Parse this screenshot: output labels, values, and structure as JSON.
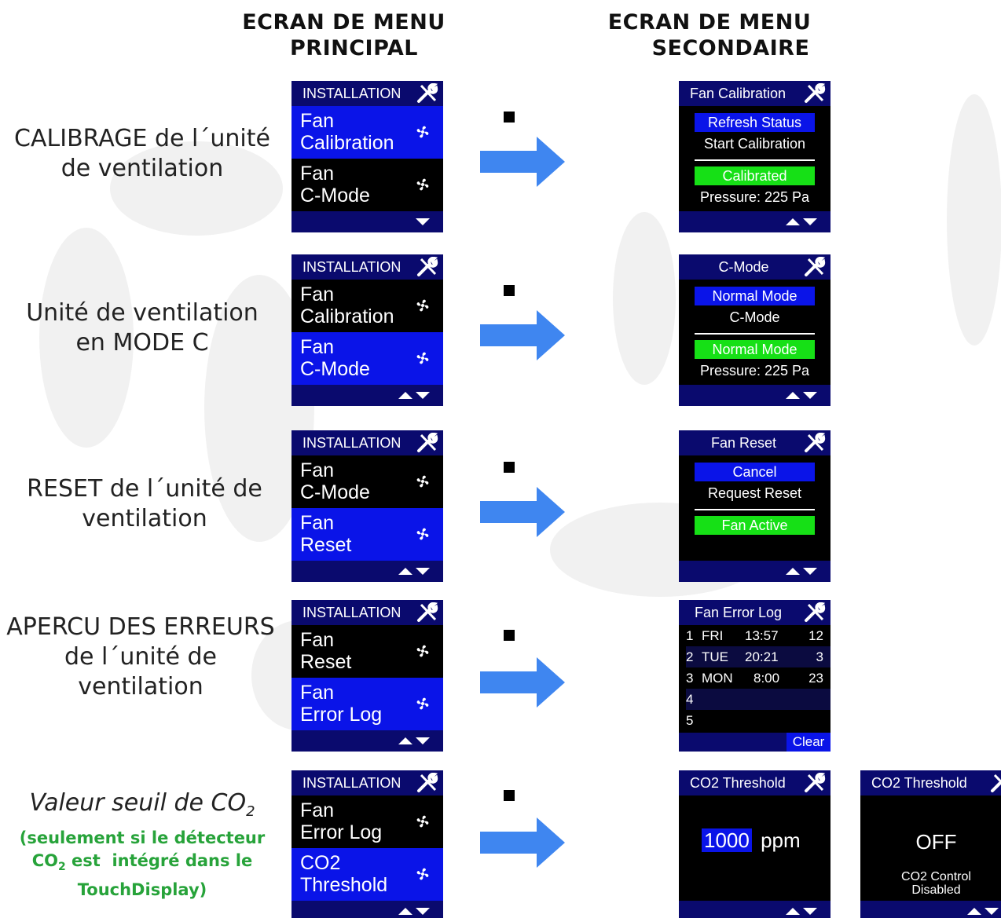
{
  "headers": {
    "main_line1": "ECRAN DE MENU",
    "main_line2": "PRINCIPAL",
    "secondary_line1": "ECRAN DE MENU",
    "secondary_line2": "SECONDAIRE"
  },
  "rows": [
    {
      "line1": "CALIBRAGE de l´unité",
      "line2": "de ventilation"
    },
    {
      "line1": "Unité de ventilation",
      "line2": "en MODE C"
    },
    {
      "line1": "RESET de l´unité de",
      "line2": "ventilation"
    },
    {
      "line1": "APERCU DES ERREURS",
      "line2": "de l´unité de",
      "line3": "ventilation"
    },
    {
      "line1": "Valeur seuil de CO",
      "sub": "2",
      "note_a": "(seulement si le détecteur",
      "note_b": "CO",
      "note_b_sub": "2",
      "note_b_rest": " est  intégré dans le",
      "note_c": "TouchDisplay)"
    }
  ],
  "main_screens": [
    {
      "title": "INSTALLATION",
      "items": [
        {
          "l1": "Fan",
          "l2": "Calibration"
        },
        {
          "l1": "Fan",
          "l2": "C-Mode"
        }
      ]
    },
    {
      "title": "INSTALLATION",
      "items": [
        {
          "l1": "Fan",
          "l2": "Calibration"
        },
        {
          "l1": "Fan",
          "l2": "C-Mode"
        }
      ]
    },
    {
      "title": "INSTALLATION",
      "items": [
        {
          "l1": "Fan",
          "l2": "C-Mode"
        },
        {
          "l1": "Fan",
          "l2": "Reset"
        }
      ]
    },
    {
      "title": "INSTALLATION",
      "items": [
        {
          "l1": "Fan",
          "l2": "Reset"
        },
        {
          "l1": "Fan",
          "l2": "Error Log"
        }
      ]
    },
    {
      "title": "INSTALLATION",
      "items": [
        {
          "l1": "Fan",
          "l2": "Error Log"
        },
        {
          "l1": "CO2",
          "l2": "Threshold"
        }
      ]
    }
  ],
  "calibration": {
    "title": "Fan Calibration",
    "opt1": "Refresh Status",
    "opt2": "Start Calibration",
    "status": "Calibrated",
    "pressure": "Pressure: 225 Pa"
  },
  "cmode": {
    "title": "C-Mode",
    "opt1": "Normal Mode",
    "opt2": "C-Mode",
    "status": "Normal Mode",
    "pressure": "Pressure: 225 Pa"
  },
  "reset": {
    "title": "Fan Reset",
    "opt1": "Cancel",
    "opt2": "Request Reset",
    "status": "Fan Active"
  },
  "errorlog": {
    "title": "Fan Error Log",
    "rows": [
      {
        "n": "1",
        "day": "FRI",
        "time": "13:57",
        "count": "12"
      },
      {
        "n": "2",
        "day": "TUE",
        "time": "20:21",
        "count": "3"
      },
      {
        "n": "3",
        "day": "MON",
        "time": "8:00",
        "count": "23"
      },
      {
        "n": "4",
        "day": "",
        "time": "",
        "count": ""
      },
      {
        "n": "5",
        "day": "",
        "time": "",
        "count": ""
      }
    ],
    "clear": "Clear"
  },
  "co2": {
    "title": "CO2 Threshold",
    "value": "1000",
    "unit": "ppm"
  },
  "co2_off": {
    "title": "CO2 Threshold",
    "value": "OFF",
    "line1": "CO2 Control",
    "line2": "Disabled"
  },
  "colors": {
    "title_bar": "#0a0a6e",
    "selection": "#0a14e8",
    "status_green": "#16e016",
    "arrow": "#3f86f0",
    "note_green": "#27a33a"
  },
  "icons": {
    "fan": "fan-icon",
    "wrench": "wrench-screwdriver-icon",
    "arrow": "right-arrow-icon",
    "bullet": "bullet-square-icon"
  }
}
